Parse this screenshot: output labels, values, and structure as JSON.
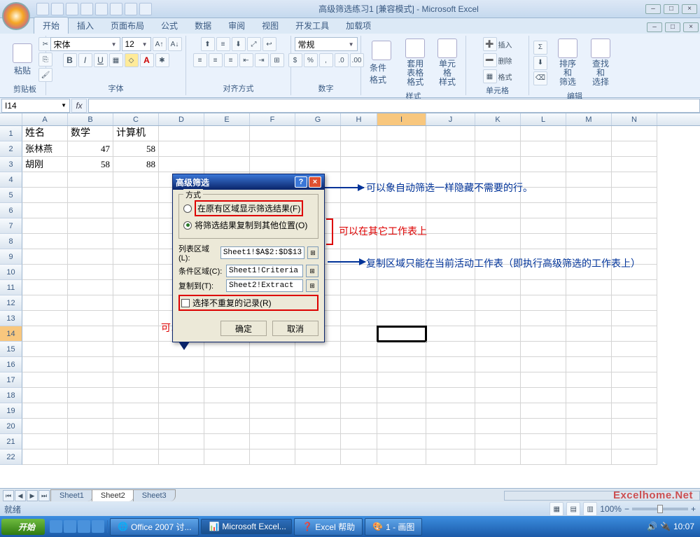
{
  "app": {
    "title": "高级筛选练习1 [兼容模式] - Microsoft Excel",
    "name_box": "I14",
    "status": "就绪",
    "zoom": "100%"
  },
  "tabs": {
    "t0": "开始",
    "t1": "插入",
    "t2": "页面布局",
    "t3": "公式",
    "t4": "数据",
    "t5": "审阅",
    "t6": "视图",
    "t7": "开发工具",
    "t8": "加载项"
  },
  "groups": {
    "clipboard": "剪贴板",
    "font": "字体",
    "align": "对齐方式",
    "number": "数字",
    "styles": "样式",
    "cells": "单元格",
    "editing": "编辑"
  },
  "ribbon": {
    "paste": "粘贴",
    "font_name": "宋体",
    "font_size": "12",
    "number_format": "常规",
    "cond_fmt": "条件格式",
    "tbl_fmt": "套用\n表格格式",
    "cell_style": "单元格\n样式",
    "insert": "插入",
    "delete": "删除",
    "format": "格式",
    "sort": "排序和\n筛选",
    "find": "查找和\n选择"
  },
  "columns": [
    "A",
    "B",
    "C",
    "D",
    "E",
    "F",
    "G",
    "H",
    "I",
    "J",
    "K",
    "L",
    "M",
    "N"
  ],
  "rows": [
    "1",
    "2",
    "3",
    "4",
    "5",
    "6",
    "7",
    "8",
    "9",
    "10",
    "11",
    "12",
    "13",
    "14",
    "15",
    "16",
    "17",
    "18",
    "19",
    "20",
    "21",
    "22"
  ],
  "chart_data": {
    "type": "table",
    "headers": [
      "姓名",
      "数学",
      "计算机"
    ],
    "rows": [
      {
        "name": "张林燕",
        "math": 47,
        "comp": 58
      },
      {
        "name": "胡刚",
        "math": 58,
        "comp": 88
      }
    ]
  },
  "dialog": {
    "title": "高级筛选",
    "mode_legend": "方式",
    "radio1": "在原有区域显示筛选结果(F)",
    "radio2": "将筛选结果复制到其他位置(O)",
    "list_lbl": "列表区域(L):",
    "list_val": "Sheet1!$A$2:$D$13",
    "crit_lbl": "条件区域(C):",
    "crit_val": "Sheet1!Criteria",
    "copy_lbl": "复制到(T):",
    "copy_val": "Sheet2!Extract",
    "unique": "选择不重复的记录(R)",
    "ok": "确定",
    "cancel": "取消"
  },
  "annotations": {
    "a1": "可以象自动筛选一样隐藏不需要的行。",
    "a2": "可以在其它工作表上",
    "a3": "复制区域只能在当前活动工作表（即执行高级筛选的工作表上）",
    "a4": "可以筛选唯一值（不重复值）。"
  },
  "sheets": {
    "s1": "Sheet1",
    "s2": "Sheet2",
    "s3": "Sheet3"
  },
  "taskbar": {
    "start": "开始",
    "t1": "Office 2007 讨...",
    "t2": "Microsoft Excel...",
    "t3": "Excel 帮助",
    "t4": "1 - 画图",
    "time": "10:07"
  },
  "watermark": "Excelhome.Net"
}
